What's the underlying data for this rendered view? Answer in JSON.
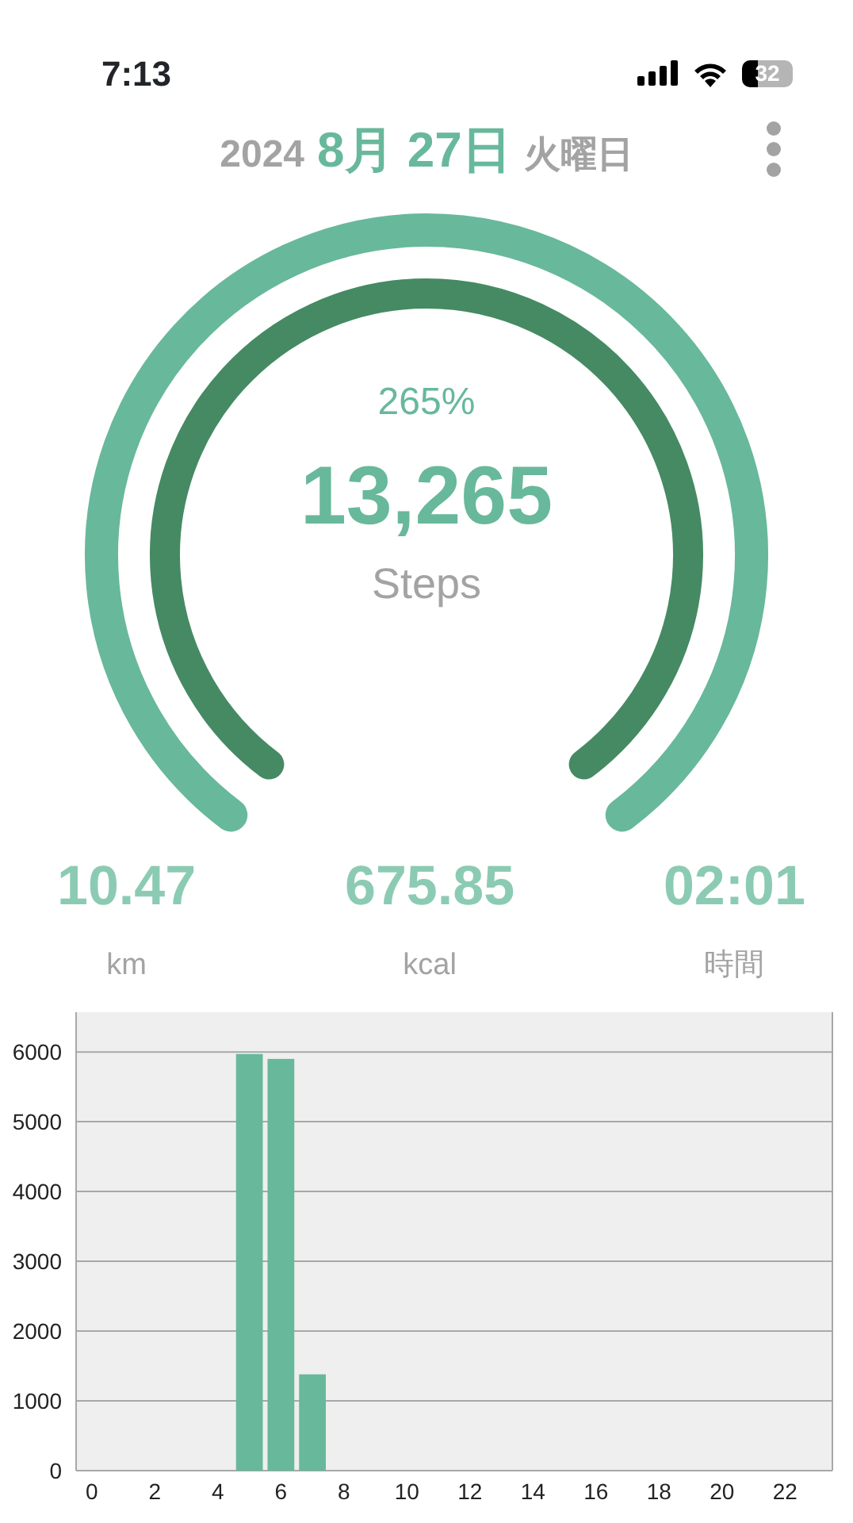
{
  "status_bar": {
    "time": "7:13",
    "battery": "32"
  },
  "date": {
    "year": "2024",
    "month_day": "8月 27日",
    "weekday": "火曜日"
  },
  "gauge": {
    "percent": "265%",
    "steps": "13,265",
    "unit": "Steps"
  },
  "stats": [
    {
      "value": "10.47",
      "unit": "km"
    },
    {
      "value": "675.85",
      "unit": "kcal"
    },
    {
      "value": "02:01",
      "unit": "時間"
    }
  ],
  "chart_data": {
    "type": "bar",
    "x": [
      5,
      6,
      7
    ],
    "series": [
      {
        "color": "#68b89c",
        "values": [
          5970,
          5900,
          1380
        ]
      }
    ],
    "xlim": [
      -0.5,
      23.5
    ],
    "ylim": [
      0,
      6570
    ],
    "yticks": [
      0,
      1000,
      2000,
      3000,
      4000,
      5000,
      6000
    ],
    "xticks": [
      0,
      2,
      4,
      6,
      8,
      10,
      12,
      14,
      16,
      18,
      20,
      22
    ],
    "grid": true
  }
}
